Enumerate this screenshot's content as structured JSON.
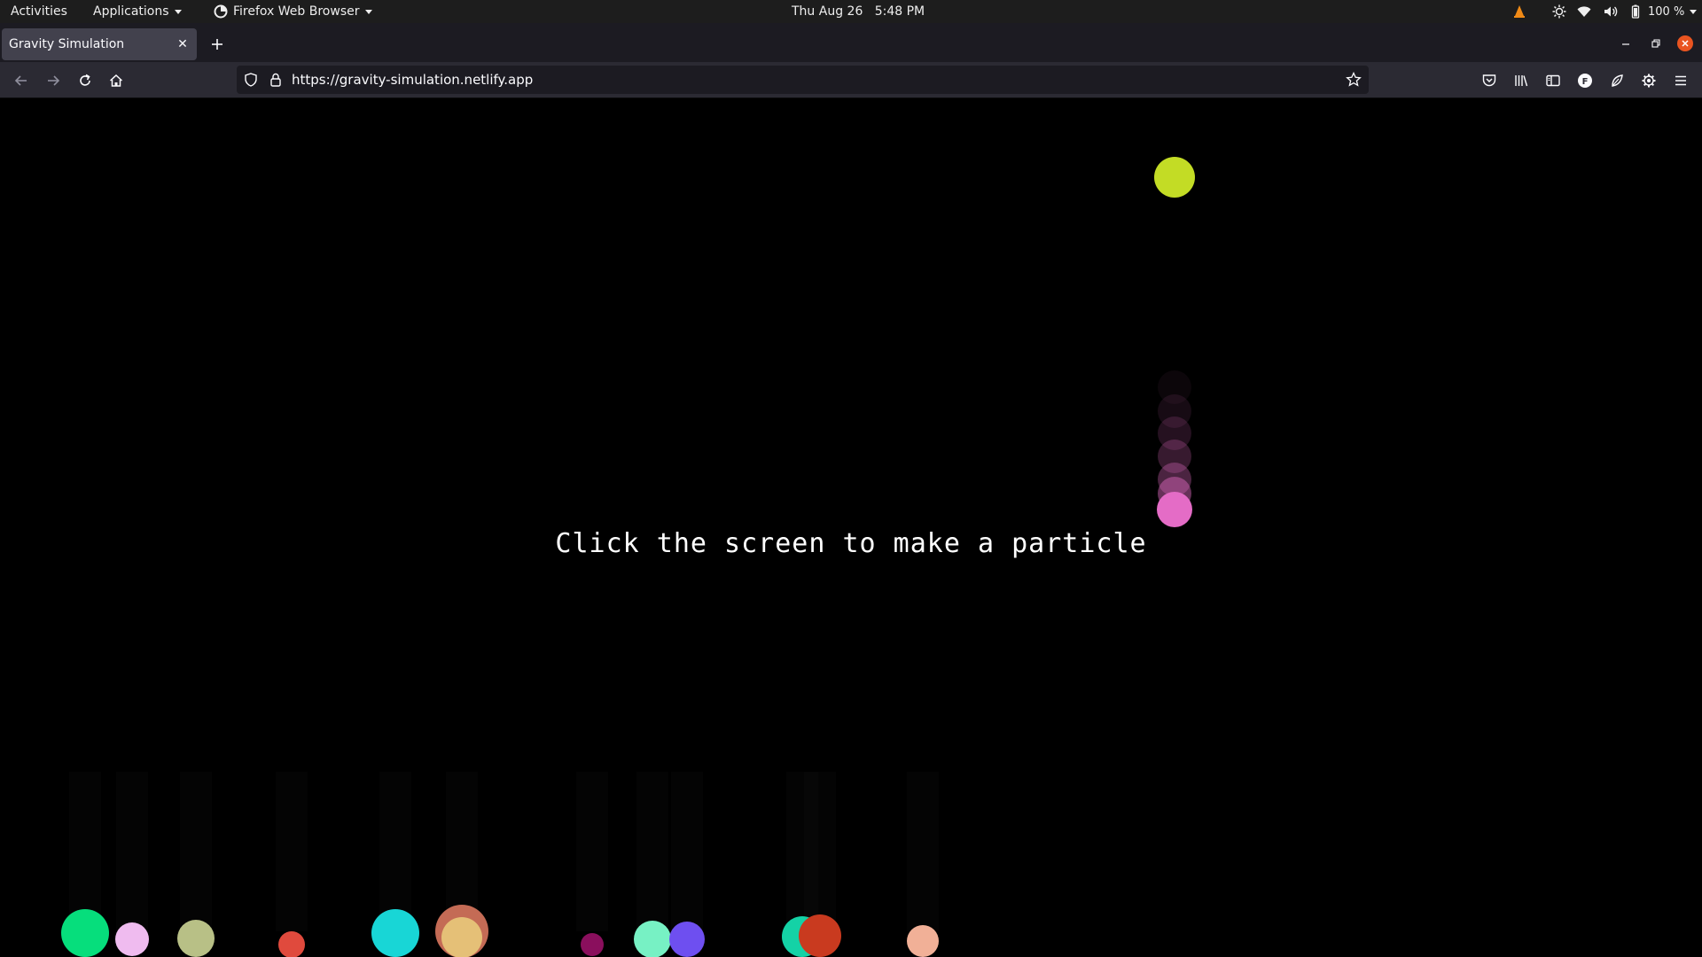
{
  "topbar": {
    "activities": "Activities",
    "applications": "Applications",
    "app_name": "Firefox Web Browser",
    "clock": "Thu Aug 26   5:48 PM",
    "battery": "100 %"
  },
  "browser": {
    "tab_title": "Gravity Simulation",
    "url": "https://gravity-simulation.netlify.app",
    "account_badge": "F"
  },
  "page": {
    "instructions": "Click the screen to make a particle"
  },
  "particles": [
    {
      "color": "#c3dc25"
    },
    {
      "color": "#e46cc6"
    },
    {
      "color": "#06de7c"
    },
    {
      "color": "#efbbef"
    },
    {
      "color": "#b8c086"
    },
    {
      "color": "#e04a3d"
    },
    {
      "color": "#18d6d6"
    },
    {
      "color": "#c46b55"
    },
    {
      "color": "#e5c077"
    },
    {
      "color": "#8a0f5d"
    },
    {
      "color": "#77f1c4"
    },
    {
      "color": "#6e4ff0"
    },
    {
      "color": "#14d2a6"
    },
    {
      "color": "#c93a1f"
    },
    {
      "color": "#f1b097"
    }
  ]
}
